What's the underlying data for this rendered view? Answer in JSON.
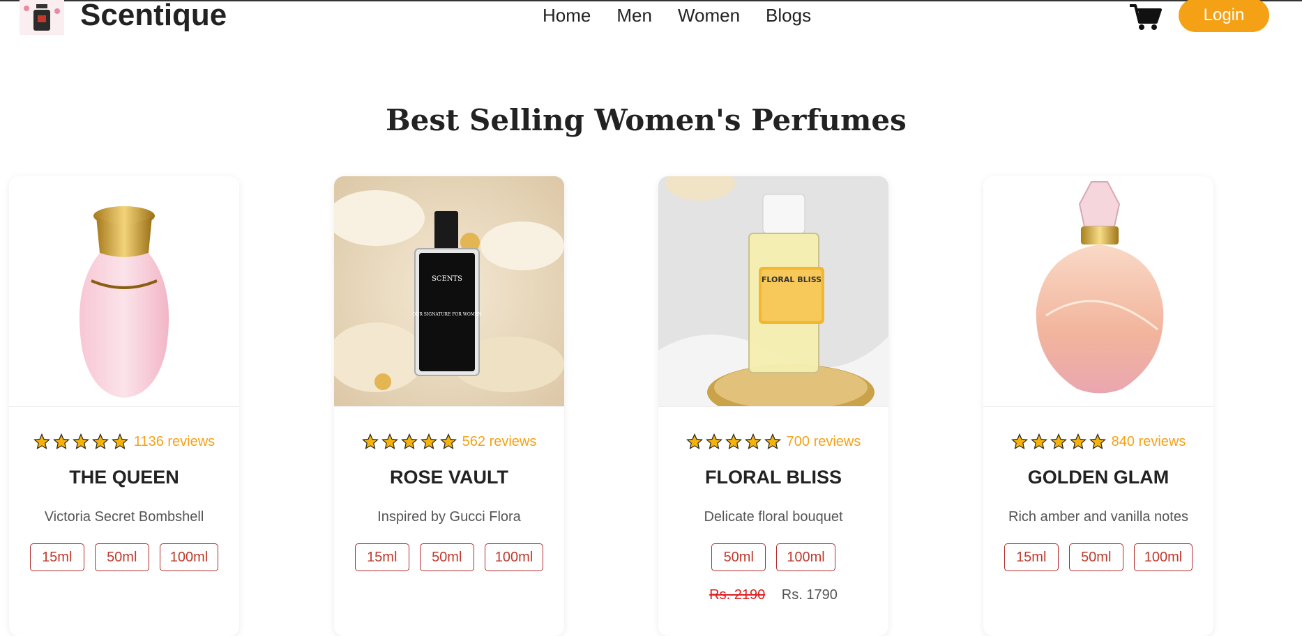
{
  "header": {
    "brand": "Scentique",
    "nav": [
      "Home",
      "Men",
      "Women",
      "Blogs"
    ],
    "login_label": "Login"
  },
  "section": {
    "title": "Best Selling Women's Perfumes"
  },
  "colors": {
    "accent": "#f5a116",
    "size_border": "#b22a2a",
    "old_price": "#e02020"
  },
  "products": [
    {
      "reviews": "1136 reviews",
      "rating": 5,
      "name": "THE QUEEN",
      "description": "Victoria Secret Bombshell",
      "sizes": [
        "15ml",
        "50ml",
        "100ml"
      ]
    },
    {
      "reviews": "562 reviews",
      "rating": 5,
      "name": "ROSE VAULT",
      "description": "Inspired by Gucci Flora",
      "sizes": [
        "15ml",
        "50ml",
        "100ml"
      ]
    },
    {
      "reviews": "700 reviews",
      "rating": 5,
      "name": "FLORAL BLISS",
      "description": "Delicate floral bouquet",
      "sizes": [
        "50ml",
        "100ml"
      ],
      "old_price": "Rs. 2190",
      "price": "Rs. 1790"
    },
    {
      "reviews": "840 reviews",
      "rating": 5,
      "name": "GOLDEN GLAM",
      "description": "Rich amber and vanilla notes",
      "sizes": [
        "15ml",
        "50ml",
        "100ml"
      ]
    }
  ],
  "images": {
    "card2_label": "SCENTS",
    "card2_sub": "OUR SIGNATURE FOR WOMEN",
    "card3_label": "FLORAL BLISS"
  }
}
